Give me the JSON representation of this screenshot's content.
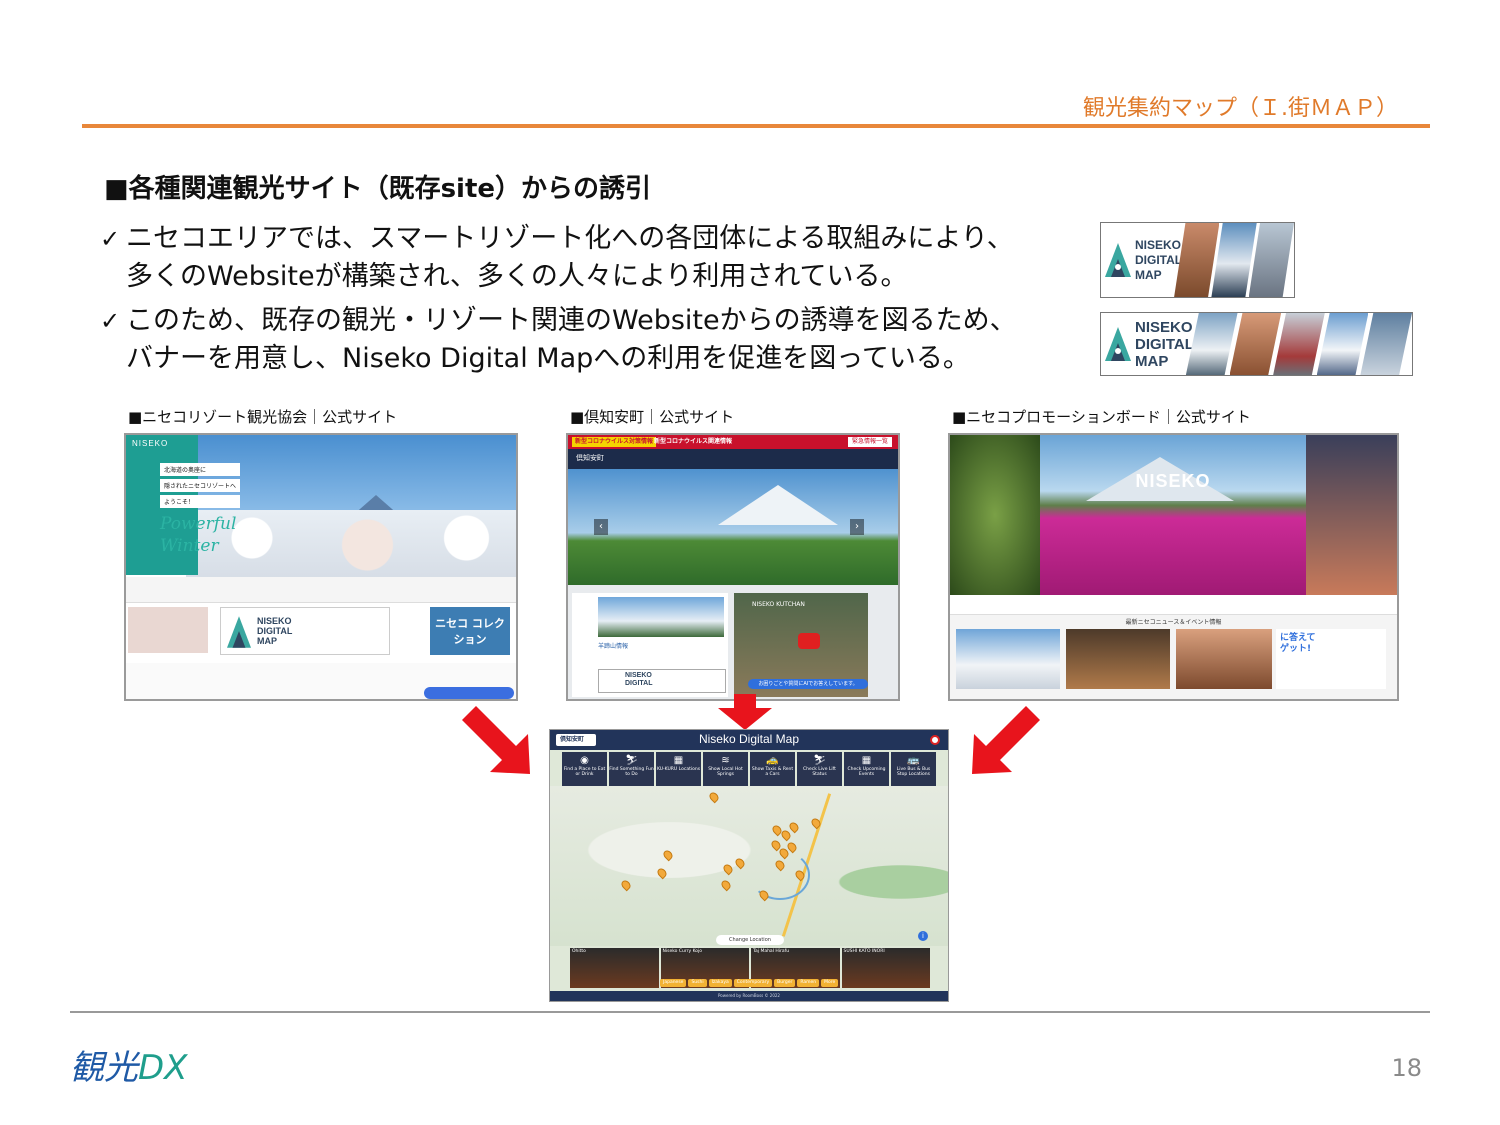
{
  "header": {
    "title": "観光集約マップ（Ｉ.街ＭＡＰ）"
  },
  "section": {
    "heading": "■各種関連観光サイト（既存site）からの誘引"
  },
  "bullets": [
    {
      "mark": "✓",
      "line1": "ニセコエリアでは、スマートリゾート化への各団体による取組みにより、",
      "line2": "多くのWebsiteが構築され、多くの人々により利用されている。"
    },
    {
      "mark": "✓",
      "line1": "このため、既存の観光・リゾート関連のWebsiteからの誘導を図るため、",
      "line2": "バナーを用意し、Niseko Digital Mapへの利用を促進を図っている。"
    }
  ],
  "banner": {
    "line1": "NISEKO",
    "line2": "DIGITAL",
    "line3": "MAP"
  },
  "sites": [
    {
      "caption": "■ニセコリゾート観光協会｜公式サイト"
    },
    {
      "caption": "■倶知安町｜公式サイト"
    },
    {
      "caption": "■ニセコプロモーションボード｜公式サイト"
    }
  ],
  "site1": {
    "brand": "NISEKO",
    "tags": [
      "北海道の奥座に",
      "隠されたニセコリゾートへ",
      "ようこそ！"
    ],
    "script1": "Powerful",
    "script2": "Winter",
    "card3": "ニセコ コレクション"
  },
  "site2": {
    "covid_tag": "新型コロナウイルス対策情報",
    "covid_text": "新型コロナウイルス関連情報",
    "top_button": "緊急情報一覧",
    "logo": "倶知安町",
    "card_title": "羊蹄山情報",
    "video_title": "NISEKO KUTCHAN",
    "chat": "お困りごとや質問にAIでお答えしています。"
  },
  "site3": {
    "title": "NISEKO",
    "news_head": "最新ニセコニュース＆イベント情報",
    "ad_line1": "に答えて",
    "ad_line2": "ゲット!"
  },
  "map": {
    "logo": "倶知安町",
    "title": "Niseko Digital Map",
    "buttons": [
      {
        "icon": "◉",
        "label": "Find a Place to Eat or Drink"
      },
      {
        "icon": "⛷",
        "label": "Find Something Fun to Do"
      },
      {
        "icon": "▦",
        "label": "KU-KURU Locations"
      },
      {
        "icon": "≋",
        "label": "Show Local Hot Springs"
      },
      {
        "icon": "🚕",
        "label": "Show Taxis & Rent a Cars"
      },
      {
        "icon": "⛷",
        "label": "Check Live Lift Status"
      },
      {
        "icon": "▦",
        "label": "Check Upcoming Events"
      },
      {
        "icon": "🚌",
        "label": "Live Bus & Bus Stop Locations"
      }
    ],
    "search": "Change Location",
    "info": "i",
    "cards": [
      "Ohitto",
      "Niseko Curry Kojo",
      "Taj Mahal Hirafu",
      "SUSHI KATO INORI"
    ],
    "tags": [
      "Japanese",
      "Sushi",
      "Izakaya",
      "Contemporary",
      "Burger",
      "Ramen",
      "More"
    ],
    "footer": "Powered by RoomBoss © 2022"
  },
  "footer": {
    "logo_kan": "観光",
    "logo_dx": "DX",
    "page": "18"
  },
  "colors": {
    "accent": "#e8873a",
    "title": "#e07a2a",
    "arrow": "#e8141c",
    "navy": "#2f4660"
  }
}
